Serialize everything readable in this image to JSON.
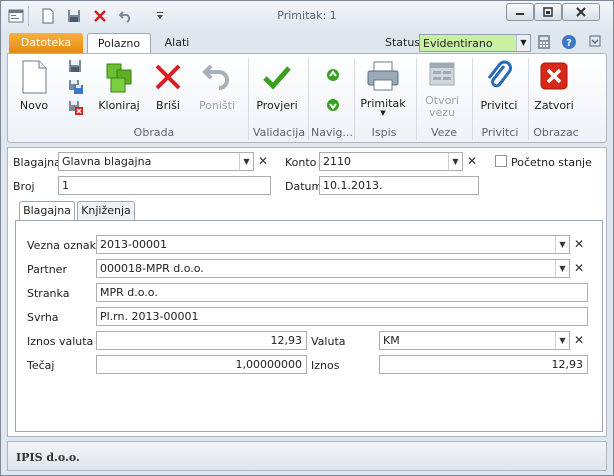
{
  "window": {
    "title": "Primitak: 1"
  },
  "ribbon_tabs": {
    "file": "Datoteka",
    "home": "Polazno",
    "tools": "Alati"
  },
  "status": {
    "label": "Status",
    "value": "Evidentirano"
  },
  "ribbon": {
    "novo": "Novo",
    "kloniraj": "Kloniraj",
    "brisi": "Briši",
    "ponisti": "Poništi",
    "provjeri": "Provjeri",
    "primitak": "Primitak",
    "otvori_vezu": "Otvori vezu",
    "privitci": "Privitci",
    "zatvori": "Zatvori",
    "groups": {
      "obrada": "Obrada",
      "validacija": "Validacija",
      "navig": "Navig...",
      "ispis": "Ispis",
      "veze": "Veze",
      "privitci": "Privitci",
      "obrazac": "Obrazac"
    }
  },
  "header_form": {
    "blagajna_label": "Blagajna",
    "blagajna_value": "Glavna blagajna",
    "konto_label": "Konto",
    "konto_value": "2110",
    "pocetno_label": "Početno stanje",
    "broj_label": "Broj",
    "broj_value": "1",
    "datum_label": "Datum",
    "datum_value": "10.1.2013."
  },
  "subtabs": {
    "blagajna": "Blagajna",
    "knjizenja": "Knjiženja"
  },
  "detail": {
    "vezna_label": "Vezna oznaka",
    "vezna_value": "2013-00001",
    "partner_label": "Partner",
    "partner_value": "000018-MPR d.o.o.",
    "stranka_label": "Stranka",
    "stranka_value": "MPR d.o.o.",
    "svrha_label": "Svrha",
    "svrha_value": "Pl.rn. 2013-00001",
    "iznos_valuta_label": "Iznos valuta",
    "iznos_valuta_value": "12,93",
    "valuta_label": "Valuta",
    "valuta_value": "KM",
    "tecaj_label": "Tečaj",
    "tecaj_value": "1,00000000",
    "iznos_label": "Iznos",
    "iznos_value": "12,93"
  },
  "footer": {
    "company": "IPIS d.o.o."
  }
}
